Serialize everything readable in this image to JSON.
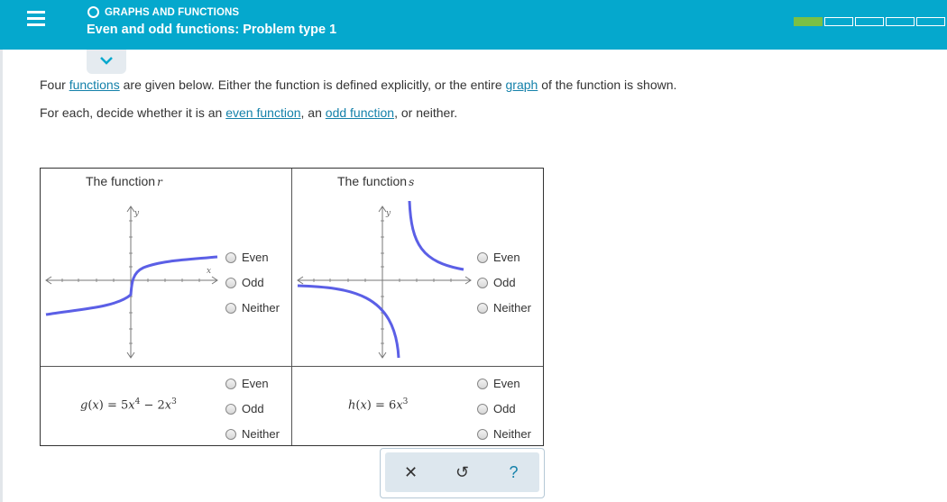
{
  "header": {
    "topic": "GRAPHS AND FUNCTIONS",
    "title": "Even and odd functions: Problem type 1",
    "progress_segments": 5,
    "progress_filled": 1,
    "accent_color": "#05a8cd"
  },
  "intro": {
    "line1": {
      "t1": "Four ",
      "link1": "functions",
      "t2": " are given below. Either the function is defined explicitly, or the entire ",
      "link2": "graph",
      "t3": " of the function is shown."
    },
    "line2": {
      "t1": "For each, decide whether it is an ",
      "link1": "even function",
      "t2": ", an ",
      "link2": "odd function",
      "t3": ", or neither."
    }
  },
  "problems": {
    "r": {
      "title": "The function",
      "name": "r"
    },
    "s": {
      "title": "The function",
      "name": "s"
    },
    "g": {
      "fname": "g",
      "var": "x",
      "eq": "= 5",
      "exp1": "4",
      "mid": " − 2",
      "exp2": "3"
    },
    "h": {
      "fname": "h",
      "var": "x",
      "eq": "= 6",
      "exp1": "3"
    }
  },
  "axis_labels": {
    "x": "x",
    "y": "y"
  },
  "options": {
    "even": "Even",
    "odd": "Odd",
    "neither": "Neither"
  },
  "toolbar": {
    "clear": "✕",
    "undo": "↺",
    "help": "?"
  }
}
